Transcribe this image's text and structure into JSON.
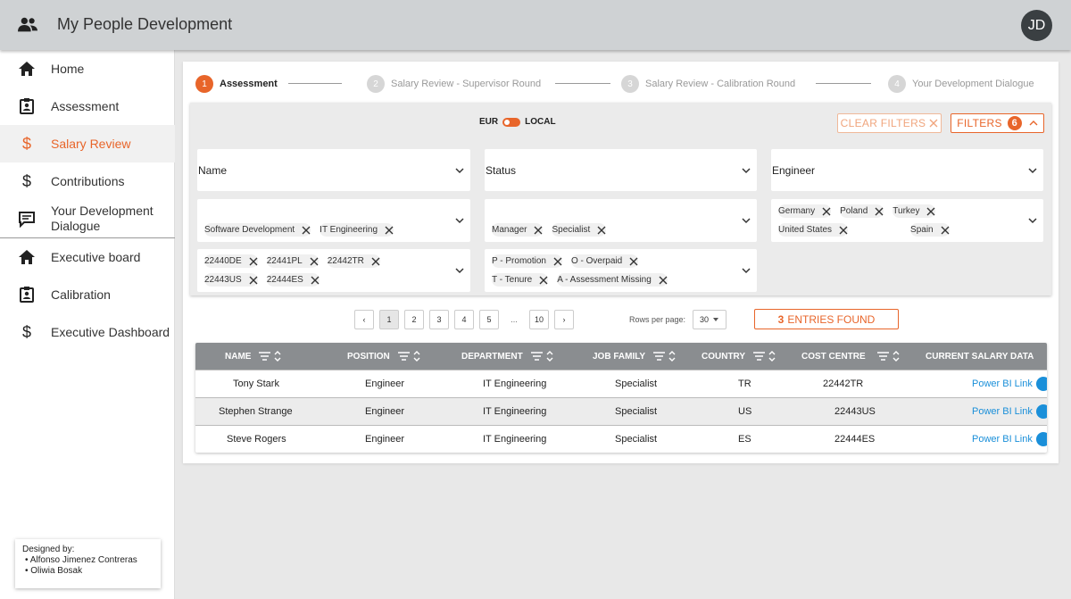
{
  "header": {
    "title": "My People Development",
    "avatar_initials": "JD"
  },
  "sidebar": {
    "items": [
      {
        "label": "Home",
        "icon": "home-icon"
      },
      {
        "label": "Assessment",
        "icon": "badge-icon"
      },
      {
        "label": "Salary Review",
        "icon": "dollar-icon",
        "active": true
      },
      {
        "label": "Contributions",
        "icon": "dollar-icon"
      },
      {
        "label": "Your Development Dialogue",
        "icon": "chat-icon"
      },
      {
        "label": "Executive board",
        "icon": "home-icon"
      },
      {
        "label": "Calibration",
        "icon": "badge-icon"
      },
      {
        "label": "Executive Dashboard",
        "icon": "dollar-icon"
      }
    ],
    "credits": {
      "title": "Designed by:",
      "names": [
        "Alfonso Jimenez Contreras",
        "Oliwia Bosak"
      ]
    }
  },
  "stepper": {
    "steps": [
      {
        "num": "1",
        "label": "Assessment",
        "active": true
      },
      {
        "num": "2",
        "label": "Salary Review - Supervisor Round"
      },
      {
        "num": "3",
        "label": "Salary Review - Calibration Round"
      },
      {
        "num": "4",
        "label": "Your Development Dialogue"
      }
    ]
  },
  "filters": {
    "currency_left": "EUR",
    "currency_right": "LOCAL",
    "clear_label": "CLEAR FILTERS",
    "filters_label": "FILTERS",
    "filters_count": "6",
    "name_label": "Name",
    "status_label": "Status",
    "role_label": "Engineer",
    "departments": [
      "Software Development",
      "IT Engineering"
    ],
    "positions": [
      "Manager",
      "Specialist"
    ],
    "countries": [
      "Germany",
      "Poland",
      "Turkey",
      "United States",
      "Spain"
    ],
    "cost_centres": [
      "22440DE",
      "22441PL",
      "22442TR",
      "22443US",
      "22444ES"
    ],
    "statuses": [
      "P - Promotion",
      "O - Overpaid",
      "T - Tenure",
      "A - Assessment Missing"
    ]
  },
  "pagination": {
    "prev": "‹",
    "pages": [
      "1",
      "2",
      "3",
      "4",
      "5"
    ],
    "ellipsis": "...",
    "last": "10",
    "next": "›",
    "rows_label": "Rows per page:",
    "rows_value": "30",
    "entries_count": "3",
    "entries_label": "ENTRIES FOUND"
  },
  "table": {
    "columns": [
      "NAME",
      "POSITION",
      "DEPARTMENT",
      "JOB FAMILY",
      "COUNTRY",
      "COST CENTRE",
      "CURRENT SALARY DATA"
    ],
    "rows": [
      [
        "Tony Stark",
        "Engineer",
        "IT Engineering",
        "Specialist",
        "TR",
        "22442TR",
        "Power BI Link"
      ],
      [
        "Stephen Strange",
        "Engineer",
        "IT Engineering",
        "Specialist",
        "US",
        "22443US",
        "Power BI Link"
      ],
      [
        "Steve Rogers",
        "Engineer",
        "IT Engineering",
        "Specialist",
        "ES",
        "22444ES",
        "Power BI Link"
      ]
    ]
  },
  "colors": {
    "accent": "#e8652a",
    "link": "#1a8fd9",
    "header_gray": "#8a8d90"
  }
}
